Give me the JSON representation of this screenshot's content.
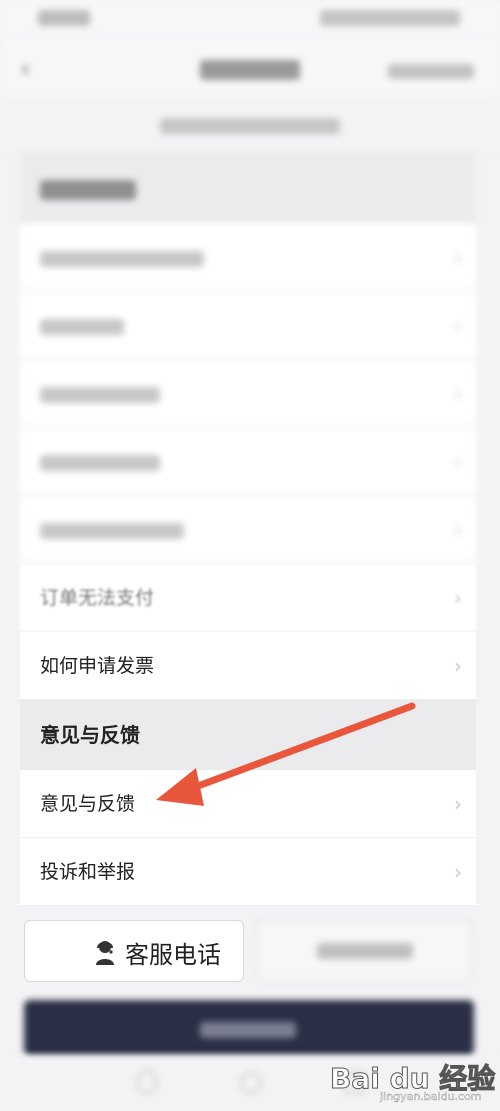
{
  "common_list": [
    {
      "label": "订单无法支付"
    },
    {
      "label": "如何申请发票"
    }
  ],
  "feedback_section": {
    "title": "意见与反馈",
    "items": [
      {
        "label": "意见与反馈"
      },
      {
        "label": "投诉和举报"
      }
    ]
  },
  "bottom": {
    "hotline_label": "客服电话"
  },
  "watermark": {
    "text": "Bai du 经验",
    "subtext": "jingyan.baidu.com"
  },
  "annotation": {
    "arrow_color": "#e8573c",
    "points_to": "意见与反馈"
  },
  "colors": {
    "primary_button": "#2b2f45",
    "background": "#f3f3f5"
  }
}
